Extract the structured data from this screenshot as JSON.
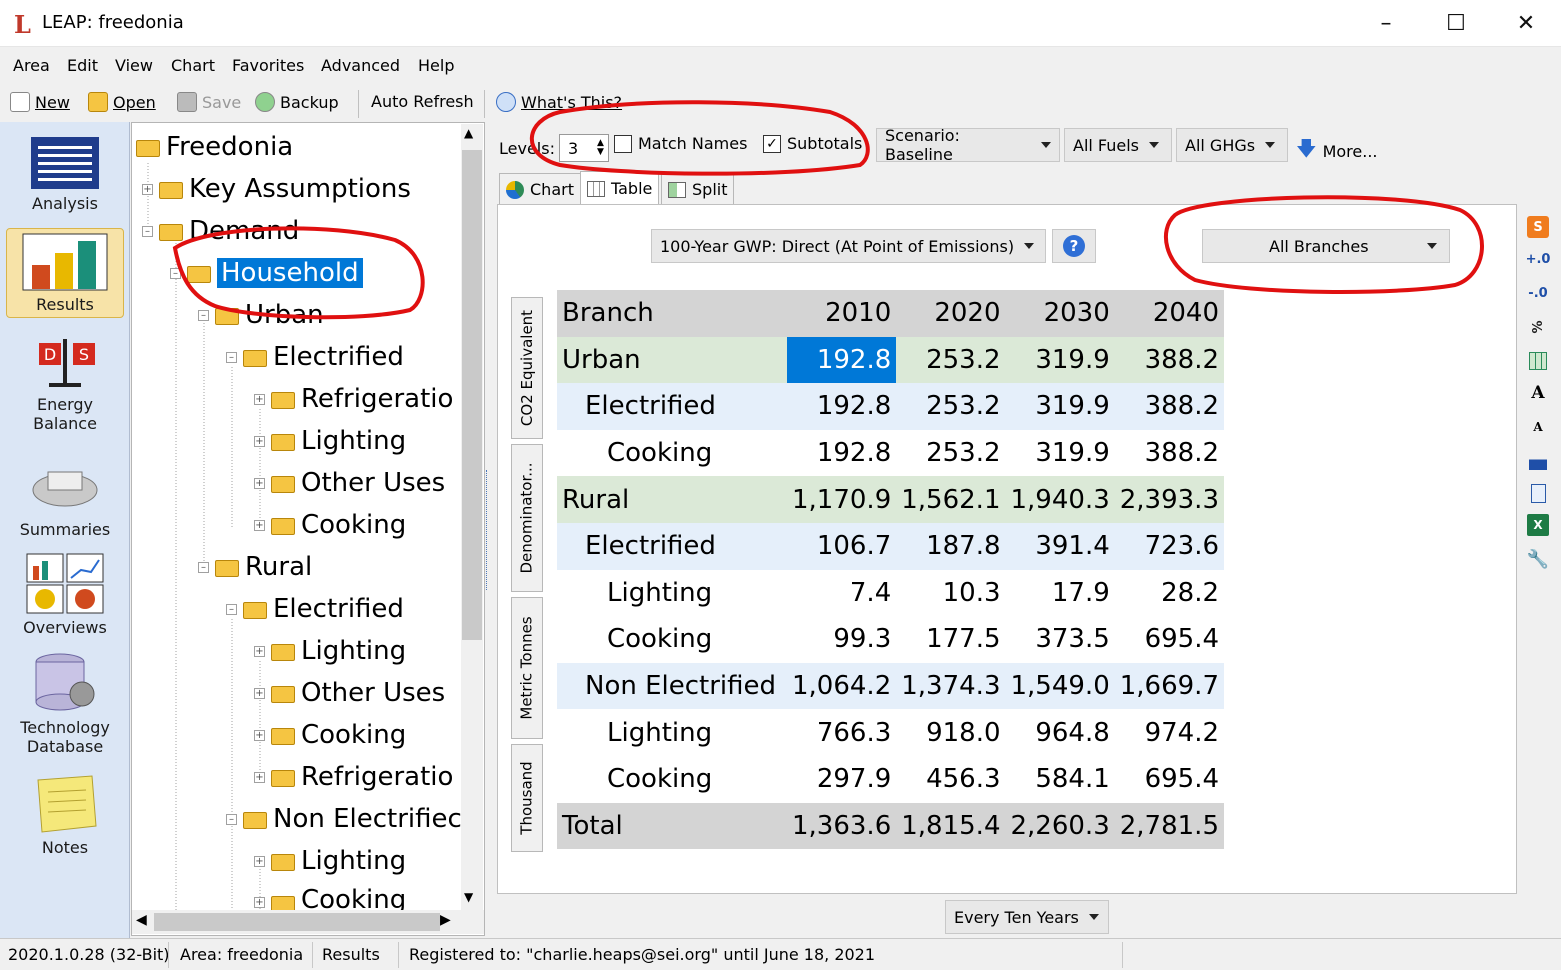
{
  "window": {
    "logo": "L",
    "title": "LEAP: freedonia"
  },
  "menu": [
    "Area",
    "Edit",
    "View",
    "Chart",
    "Favorites",
    "Advanced",
    "Help"
  ],
  "toolbar": {
    "new": "New",
    "open": "Open",
    "save": "Save",
    "backup": "Backup",
    "auto_refresh": "Auto Refresh",
    "whats_this": "What's This?"
  },
  "nav": {
    "analysis": "Analysis",
    "results": "Results",
    "energy_balance_1": "Energy",
    "energy_balance_2": "Balance",
    "summaries": "Summaries",
    "overviews": "Overviews",
    "tech_db_1": "Technology",
    "tech_db_2": "Database",
    "notes": "Notes"
  },
  "tree": [
    "Freedonia",
    "Key Assumptions",
    "Demand",
    "Household",
    "Urban",
    "Electrified",
    "Refrigeratio",
    "Lighting",
    "Other Uses",
    "Cooking",
    "Rural",
    "Electrified",
    "Lighting",
    "Other Uses",
    "Cooking",
    "Refrigeratio",
    "Non Electrifiec",
    "Lighting",
    "Cooking"
  ],
  "controls": {
    "levels_label": "Levels:",
    "levels_value": "3",
    "match_names": "Match Names",
    "subtotals": "Subtotals",
    "scenario": "Scenario: Baseline",
    "fuels": "All Fuels",
    "ghgs": "All GHGs",
    "more": "More..."
  },
  "tabs": {
    "chart": "Chart",
    "table": "Table",
    "split": "Split"
  },
  "table_controls": {
    "gwp": "100-Year GWP: Direct (At Point of Emissions)",
    "branches": "All Branches",
    "interval": "Every Ten Years"
  },
  "vtabs": [
    "CO2 Equivalent",
    "Denominator...",
    "Metric Tonnes",
    "Thousand"
  ],
  "grid": {
    "header": [
      "Branch",
      "2010",
      "2020",
      "2030",
      "2040"
    ],
    "rows": [
      [
        "Urban",
        "192.8",
        "253.2",
        "319.9",
        "388.2"
      ],
      [
        "Electrified",
        "192.8",
        "253.2",
        "319.9",
        "388.2"
      ],
      [
        "Cooking",
        "192.8",
        "253.2",
        "319.9",
        "388.2"
      ],
      [
        "Rural",
        "1,170.9",
        "1,562.1",
        "1,940.3",
        "2,393.3"
      ],
      [
        "Electrified",
        "106.7",
        "187.8",
        "391.4",
        "723.6"
      ],
      [
        "Lighting",
        "7.4",
        "10.3",
        "17.9",
        "28.2"
      ],
      [
        "Cooking",
        "99.3",
        "177.5",
        "373.5",
        "695.4"
      ],
      [
        "Non Electrified",
        "1,064.2",
        "1,374.3",
        "1,549.0",
        "1,669.7"
      ],
      [
        "Lighting",
        "766.3",
        "918.0",
        "964.8",
        "974.2"
      ],
      [
        "Cooking",
        "297.9",
        "456.3",
        "584.1",
        "695.4"
      ],
      [
        "Total",
        "1,363.6",
        "1,815.4",
        "2,260.3",
        "2,781.5"
      ]
    ]
  },
  "right_tools": {
    "t1": "S",
    "t2": "+.0",
    "t3": "-.0",
    "t4": "%",
    "t5": "A",
    "t6": "A"
  },
  "status": {
    "version": "2020.1.0.28 (32-Bit)",
    "area": "Area: freedonia",
    "view": "Results",
    "registered": "Registered to: \"charlie.heaps@sei.org\" until June 18, 2021"
  },
  "colors": {
    "selection": "#0078d7",
    "annotation": "#e01010",
    "level1_row": "#dbe9d7",
    "level2_row": "#e5effa"
  }
}
